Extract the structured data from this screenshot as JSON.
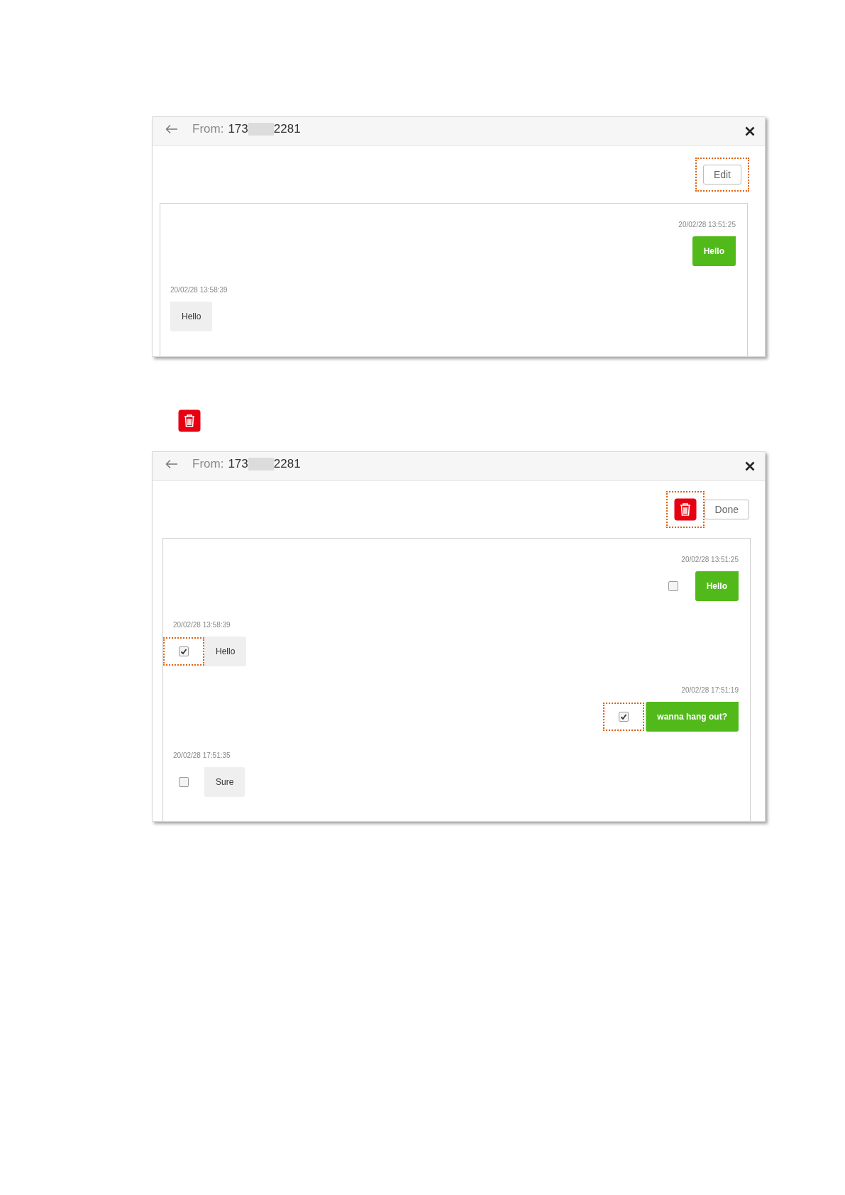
{
  "blocks": [
    {
      "kind": "panel",
      "header": {
        "from_label": "From:",
        "number_start": "173",
        "number_end": "2281"
      },
      "toolbar": [
        {
          "kind": "text",
          "label": "Edit",
          "highlighted": true
        }
      ],
      "messages": [
        {
          "kind": "sent",
          "time": "20/02/28 13:51:25",
          "text": "Hello"
        },
        {
          "kind": "received",
          "time": "20/02/28 13:58:39",
          "text": "Hello"
        }
      ]
    },
    {
      "kind": "trash_icon"
    },
    {
      "kind": "panel",
      "header": {
        "from_label": "From:",
        "number_start": "173",
        "number_end": "2281"
      },
      "toolbar": [
        {
          "kind": "delete",
          "highlighted": true
        },
        {
          "kind": "text",
          "label": "Done",
          "highlighted": false
        }
      ],
      "messages": [
        {
          "kind": "sent",
          "time": "20/02/28 13:51:25",
          "text": "Hello",
          "checked": false,
          "highlighted": false
        },
        {
          "kind": "received",
          "time": "20/02/28 13:58:39",
          "text": "Hello",
          "checked": true,
          "highlighted": true
        },
        {
          "kind": "sent",
          "time": "20/02/28 17:51:19",
          "text": "wanna hang out?",
          "checked": true,
          "highlighted": true
        },
        {
          "kind": "received",
          "time": "20/02/28 17:51:35",
          "text": "Sure",
          "checked": false,
          "highlighted": false
        }
      ]
    }
  ]
}
